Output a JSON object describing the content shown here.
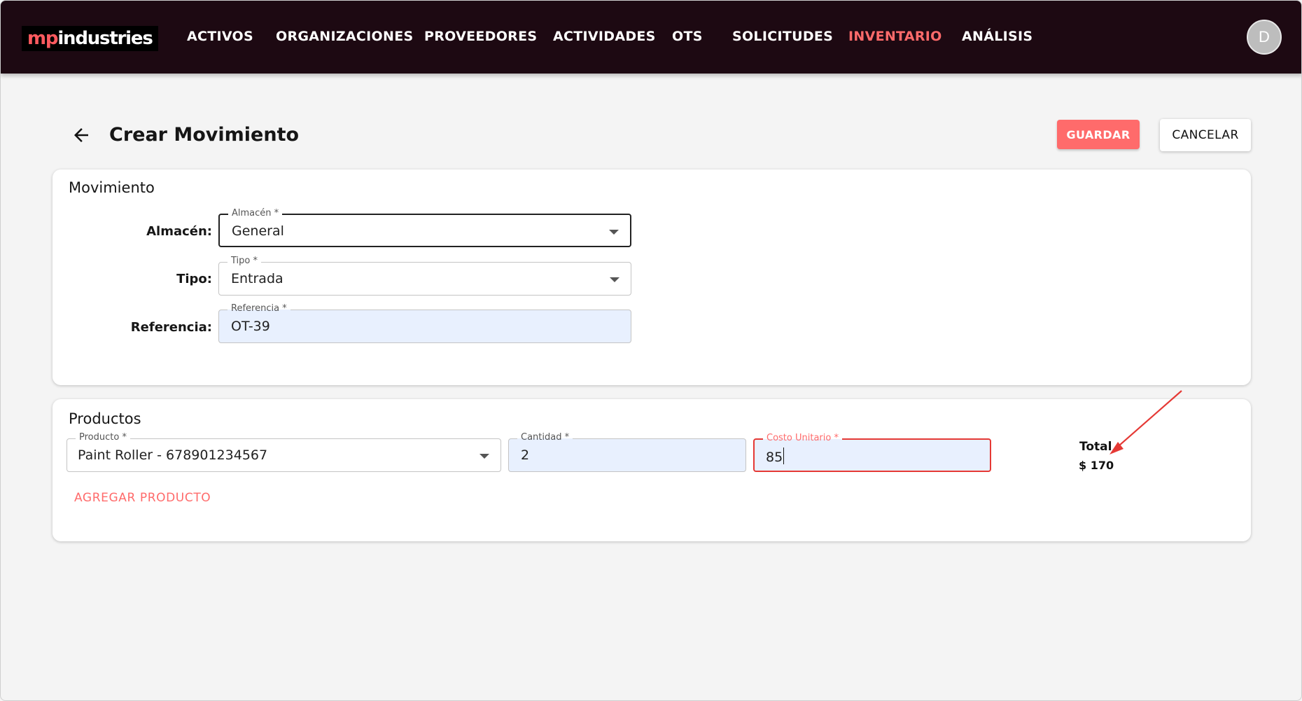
{
  "brand": {
    "logo_prefix": "mp",
    "logo_suffix": "industries"
  },
  "nav": {
    "items": [
      {
        "label": "ACTIVOS"
      },
      {
        "label": "ORGANIZACIONES"
      },
      {
        "label": "PROVEEDORES"
      },
      {
        "label": "ACTIVIDADES"
      },
      {
        "label": "OTS"
      },
      {
        "label": "SOLICITUDES"
      },
      {
        "label": "INVENTARIO",
        "active": true
      },
      {
        "label": "ANÁLISIS"
      }
    ],
    "avatar_initial": "D"
  },
  "header": {
    "title": "Crear Movimiento",
    "save_label": "GUARDAR",
    "cancel_label": "CANCELAR"
  },
  "movimiento": {
    "title": "Movimiento",
    "almacen": {
      "label": "Almacén:",
      "legend": "Almacén *",
      "value": "General"
    },
    "tipo": {
      "label": "Tipo:",
      "legend": "Tipo *",
      "value": "Entrada"
    },
    "referencia": {
      "label": "Referencia:",
      "legend": "Referencia *",
      "value": "OT-39"
    }
  },
  "productos": {
    "title": "Productos",
    "producto": {
      "legend": "Producto *",
      "value": "Paint Roller - 678901234567"
    },
    "cantidad": {
      "legend": "Cantidad *",
      "value": "2"
    },
    "costo_unitario": {
      "legend": "Costo Unitario *",
      "value": "85"
    },
    "add_label": "AGREGAR PRODUCTO",
    "total_label": "Total",
    "total_value": "$ 170"
  },
  "colors": {
    "accent": "#ff6b6b",
    "nav_bg": "#1d0912",
    "annotation": "#e53935",
    "filled_bg": "#e8f0fe"
  }
}
